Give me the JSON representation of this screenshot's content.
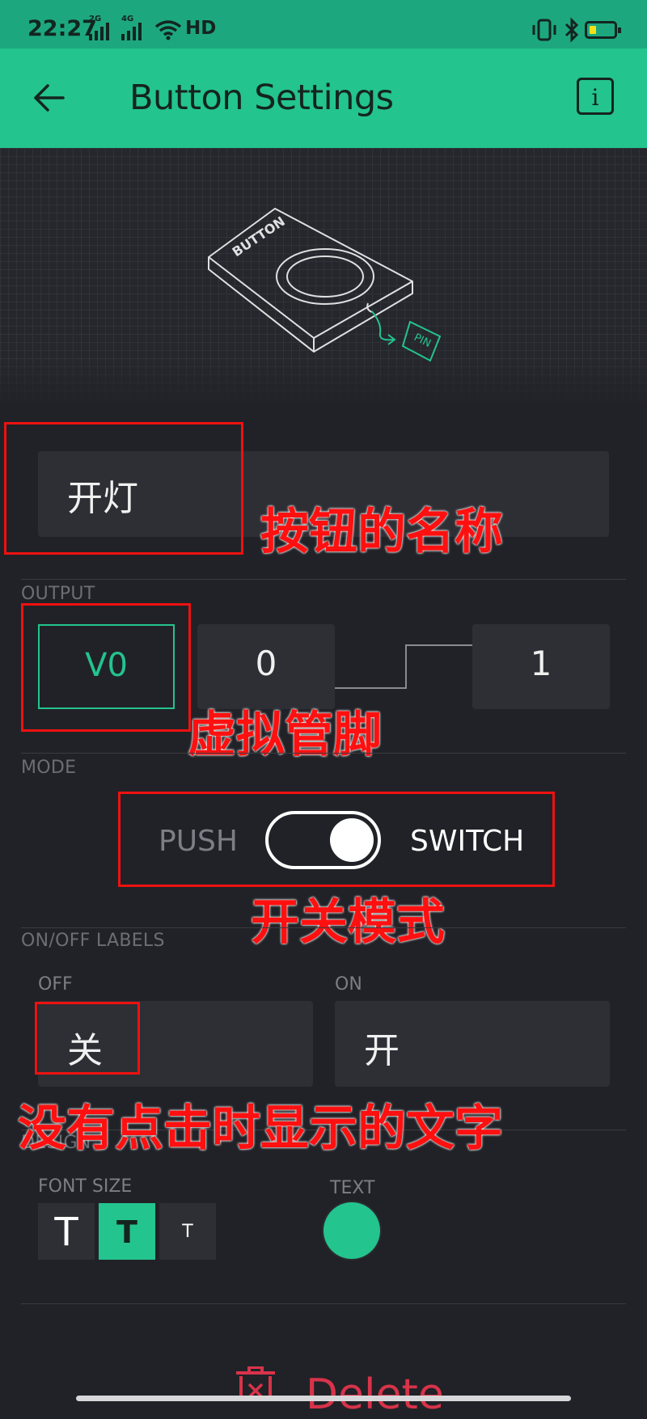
{
  "status_bar": {
    "time": "22:27",
    "signal_1": "2G",
    "signal_2": "4G",
    "network": "HD"
  },
  "header": {
    "title": "Button Settings",
    "back_icon": "arrow-left-icon",
    "info_label": "i"
  },
  "illustration": {
    "device_label": "BUTTON",
    "pin_label": "PIN"
  },
  "name_field": {
    "value": "开灯"
  },
  "output": {
    "section_label": "OUTPUT",
    "pin": "V0",
    "min_value": "0",
    "max_value": "1"
  },
  "mode": {
    "section_label": "MODE",
    "push_label": "PUSH",
    "switch_label": "SWITCH",
    "selected": "SWITCH"
  },
  "labels": {
    "section_label": "ON/OFF LABELS",
    "off_label": "OFF",
    "off_value": "关",
    "on_label": "ON",
    "on_value": "开"
  },
  "design": {
    "section_label": "DESIGN",
    "font_size_label": "FONT SIZE",
    "font_sizes": [
      "T",
      "T",
      "T"
    ],
    "selected_font_size_index": 1,
    "text_label": "TEXT",
    "text_color": "#23c48e"
  },
  "footer": {
    "delete_label": "Delete",
    "delete_icon": "trash-icon"
  },
  "annotations": {
    "name": "按钮的名称",
    "virtual_pin": "虚拟管脚",
    "switch_mode": "开关模式",
    "text_when_off": "没有点击时显示的文字"
  },
  "colors": {
    "accent": "#23c48e",
    "status_bar": "#1da77f",
    "background": "#212227",
    "annotation": "#ff1010"
  }
}
